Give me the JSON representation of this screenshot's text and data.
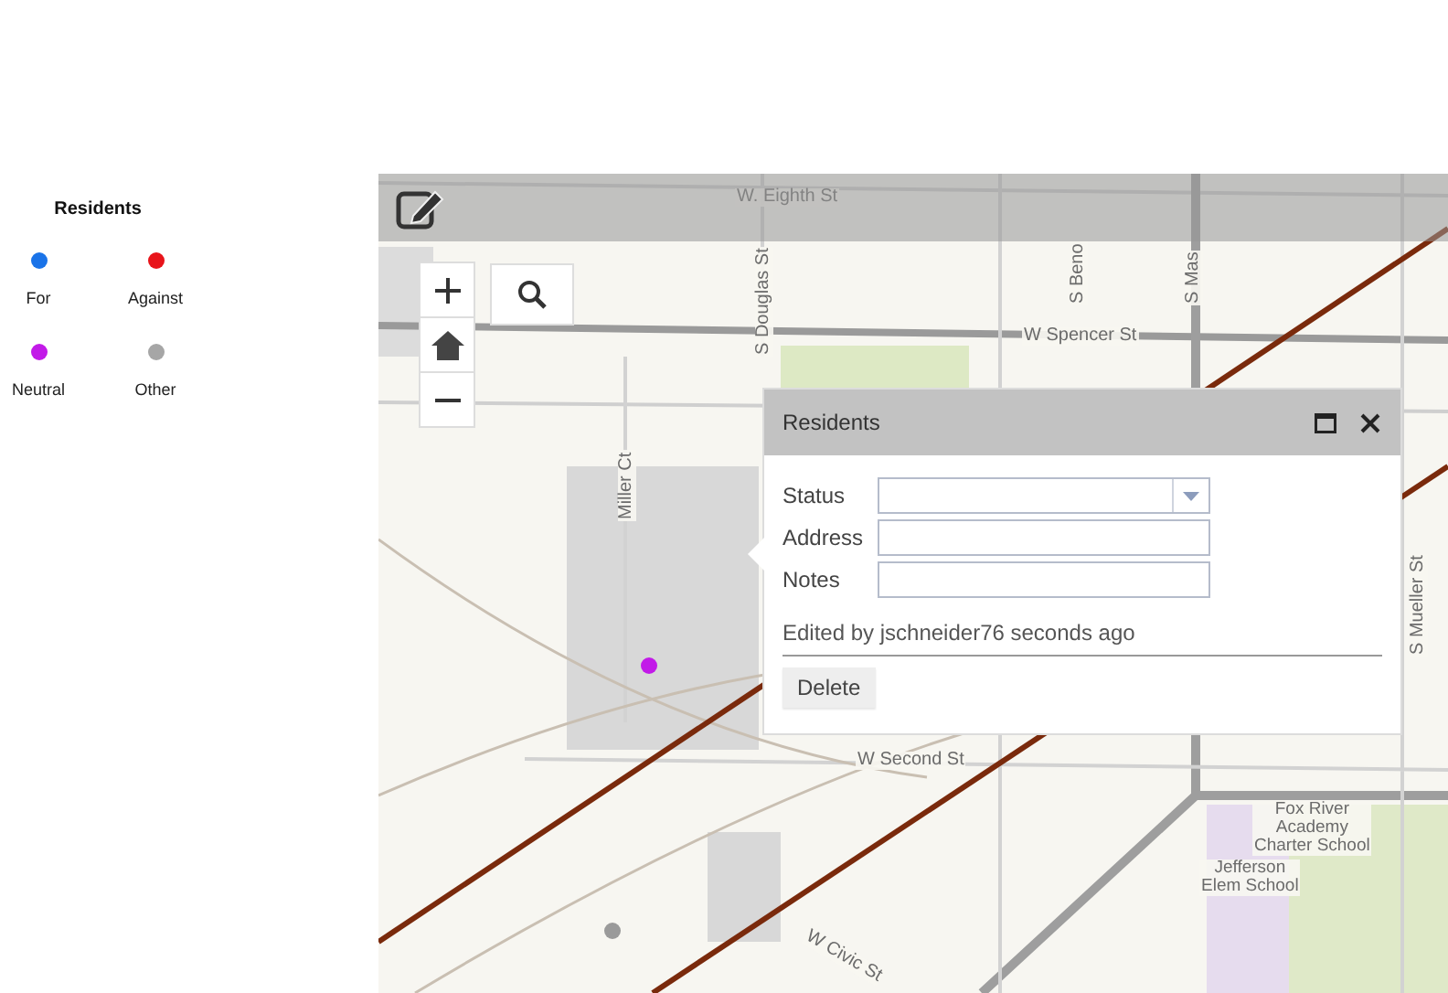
{
  "legend": {
    "title": "Residents",
    "items": [
      {
        "label": "For",
        "color": "#1a73e8"
      },
      {
        "label": "Against",
        "color": "#e8141a"
      },
      {
        "label": "Neutral",
        "color": "#c21ae8"
      },
      {
        "label": "Other",
        "color": "#a6a6a6"
      }
    ]
  },
  "map": {
    "labels": [
      {
        "text": "W. Eighth St",
        "kind": "horizontal"
      },
      {
        "text": "S Douglas St",
        "kind": "vertical"
      },
      {
        "text": "W Spencer St",
        "kind": "horizontal"
      },
      {
        "text": "S Beno",
        "kind": "vertical"
      },
      {
        "text": "S Mas",
        "kind": "vertical"
      },
      {
        "text": "Miller Ct",
        "kind": "vertical"
      },
      {
        "text": "S Mueller St",
        "kind": "vertical"
      },
      {
        "text": "W Second St",
        "kind": "horizontal"
      },
      {
        "text": "W Civic St",
        "kind": "slanted"
      },
      {
        "text": "Fox River\nAcademy\nCharter School",
        "kind": "horizontal"
      },
      {
        "text": "Jefferson\nElem School",
        "kind": "horizontal"
      }
    ]
  },
  "popup": {
    "title": "Residents",
    "fields": [
      {
        "label": "Status",
        "kind": "select"
      },
      {
        "label": "Address",
        "kind": "text"
      },
      {
        "label": "Notes",
        "kind": "text"
      }
    ],
    "edited": "Edited by jschneider76 seconds ago",
    "delete": "Delete"
  }
}
